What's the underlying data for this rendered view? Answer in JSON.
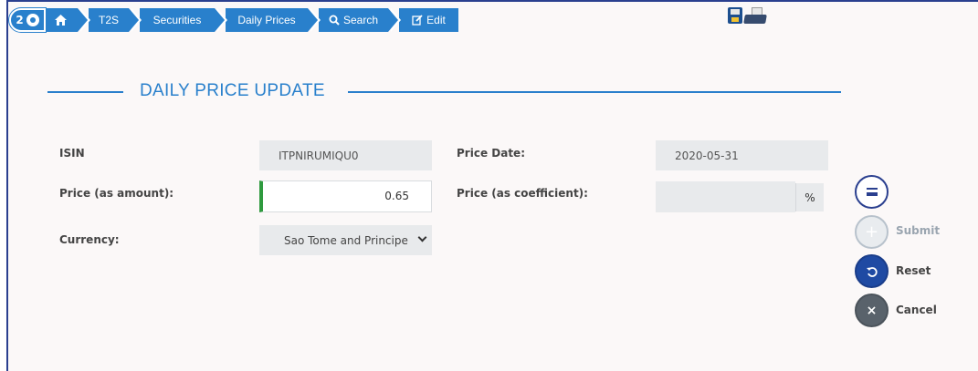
{
  "breadcrumb": {
    "badge_count": "2",
    "items": [
      {
        "label": "",
        "icon": "home-icon"
      },
      {
        "label": "T2S"
      },
      {
        "label": "Securities"
      },
      {
        "label": "Daily Prices"
      },
      {
        "label": "Search",
        "icon": "search-icon"
      },
      {
        "label": "Edit",
        "icon": "edit-icon"
      }
    ]
  },
  "toolbar": {
    "icons": [
      "save-disk-icon",
      "printer-icon"
    ]
  },
  "page": {
    "title": "DAILY PRICE UPDATE"
  },
  "form": {
    "isin_label": "ISIN",
    "isin_value": "ITPNIRUMIQU0",
    "price_date_label": "Price Date:",
    "price_date_value": "2020-05-31",
    "price_amount_label": "Price (as amount):",
    "price_amount_value": "0.65",
    "price_coeff_label": "Price (as coefficient):",
    "price_coeff_value": "",
    "price_coeff_unit": "%",
    "currency_label": "Currency:",
    "currency_value": "Sao Tome and Principe"
  },
  "actions": {
    "submit_label": "Submit",
    "reset_label": "Reset",
    "cancel_label": "Cancel"
  },
  "colors": {
    "accent": "#2980cc",
    "dark_blue": "#2a3f8f",
    "valid_green": "#2e9a3e"
  }
}
